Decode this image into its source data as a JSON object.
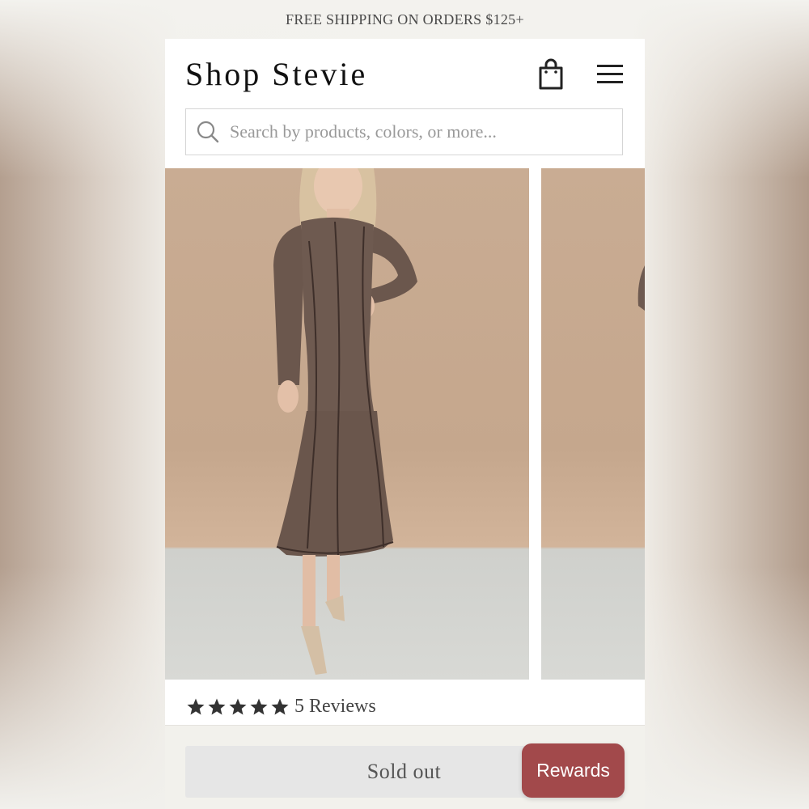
{
  "promo_banner": {
    "text": "FREE SHIPPING ON ORDERS $125+"
  },
  "header": {
    "logo": "Shop Stevie",
    "bag_icon": "shopping-bag-icon",
    "menu_icon": "hamburger-menu-icon"
  },
  "search": {
    "placeholder": "Search by products, colors, or more...",
    "value": "",
    "icon": "search-icon"
  },
  "gallery": {
    "images": [
      {
        "label": "product-photo-brown-long-sleeve-midi-dress-front"
      },
      {
        "label": "product-photo-next-partial"
      }
    ]
  },
  "rating": {
    "stars": 5,
    "reviews_label": "5 Reviews"
  },
  "actions": {
    "sold_out_label": "Sold out",
    "rewards_label": "Rewards"
  },
  "colors": {
    "rewards_bg": "#a2494b",
    "dress": "#6e5a50",
    "wall": "#c5a78d"
  }
}
